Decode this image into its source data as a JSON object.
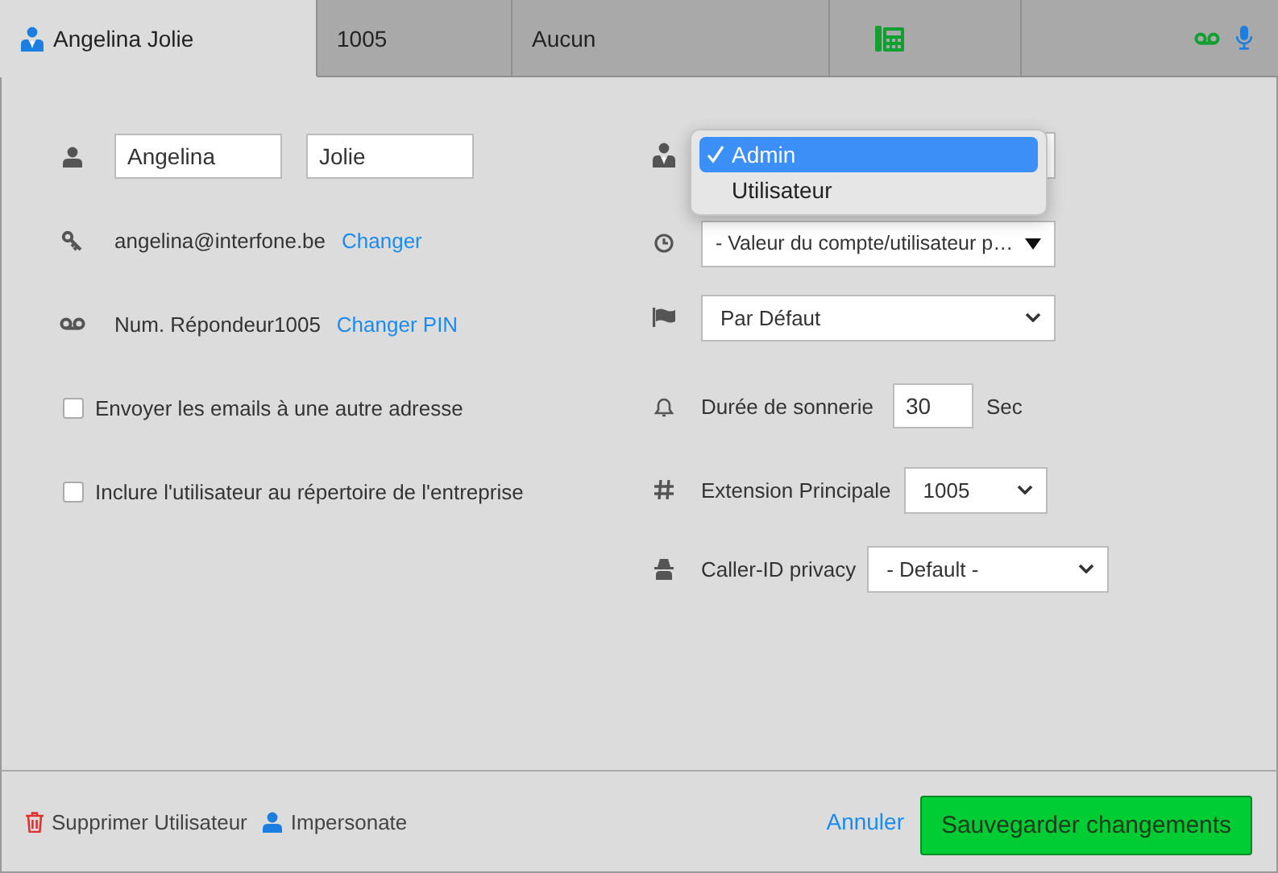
{
  "tabs": [
    {
      "kind": "user",
      "label": "Angelina Jolie",
      "selected": true
    },
    {
      "kind": "text",
      "label": "1005",
      "selected": false
    },
    {
      "kind": "text",
      "label": "Aucun",
      "selected": false
    },
    {
      "kind": "phone",
      "selected": false
    },
    {
      "kind": "media",
      "selected": false
    }
  ],
  "identity": {
    "first_name": "Angelina",
    "last_name": "Jolie",
    "email": "angelina@interfone.be",
    "change_password_link": "Changer",
    "voicemail": "Num. Répondeur1005",
    "change_pin_link": "Changer PIN"
  },
  "checkboxes": [
    {
      "label": "Envoyer les emails à une autre adresse",
      "checked": false
    },
    {
      "label": "Inclure l'utilisateur au répertoire de l'entreprise",
      "checked": false
    }
  ],
  "role": {
    "expanded": true,
    "options": [
      {
        "label": "Admin",
        "selected": true
      },
      {
        "label": "Utilisateur",
        "selected": false
      }
    ]
  },
  "schedule": {
    "value": "- Valeur du compte/utilisateur p…"
  },
  "language": {
    "value": "Par Défaut"
  },
  "ring_duration": {
    "label": "Durée de sonnerie",
    "value": "30",
    "unit": "Sec"
  },
  "main_extension": {
    "label": "Extension Principale",
    "value": "1005"
  },
  "caller_id_privacy": {
    "label": "Caller-ID privacy",
    "value": "- Default -"
  },
  "footer": {
    "delete": "Supprimer Utilisateur",
    "impersonate": "Impersonate",
    "cancel": "Annuler",
    "save": "Sauvegarder changements"
  }
}
